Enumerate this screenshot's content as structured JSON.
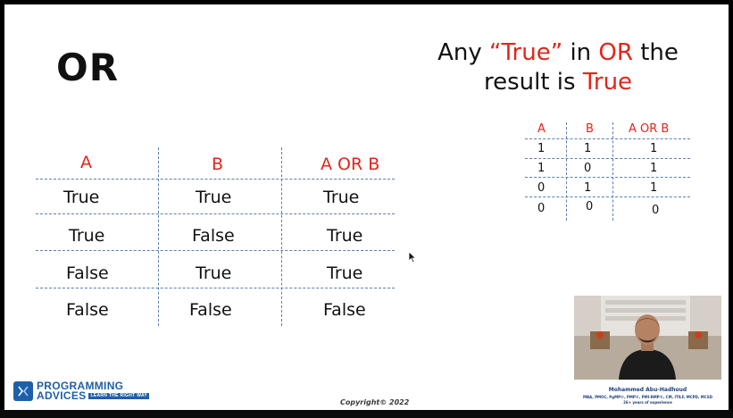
{
  "slide": {
    "title": "OR",
    "headline": {
      "part1": "Any ",
      "quoted_true": "“True”",
      "part2": " in ",
      "or_word": "OR",
      "part3": " the",
      "line2": "result is ",
      "true_word": "True"
    },
    "big_table": {
      "headers": [
        "A",
        "B",
        "A OR B"
      ],
      "rows": [
        [
          "True",
          "True",
          "True"
        ],
        [
          "True",
          "False",
          "True"
        ],
        [
          "False",
          "True",
          "True"
        ],
        [
          "False",
          "False",
          "False"
        ]
      ]
    },
    "small_table": {
      "headers": [
        "A",
        "B",
        "A OR B"
      ],
      "rows": [
        [
          "1",
          "1",
          "1"
        ],
        [
          "1",
          "0",
          "1"
        ],
        [
          "0",
          "1",
          "1"
        ],
        [
          "0",
          "0",
          "0"
        ]
      ]
    },
    "copyright": "Copyright© 2022"
  },
  "logo": {
    "line1": "PROGRAMMING",
    "line2": "ADVICES",
    "tagline": "LEARN THE RIGHT WAY"
  },
  "presenter": {
    "name": "Mohammed Abu-Hadhoud",
    "credentials": "MBA, PMOC, PgMP®, PMP®, PMI-RMP®, CM, ITILF, MCPD, MCSD",
    "experience": "26+ years of experience"
  },
  "colors": {
    "accent_red": "#e0261b",
    "dash_blue": "#5b7fb0",
    "brand_blue": "#1f5fa8"
  }
}
